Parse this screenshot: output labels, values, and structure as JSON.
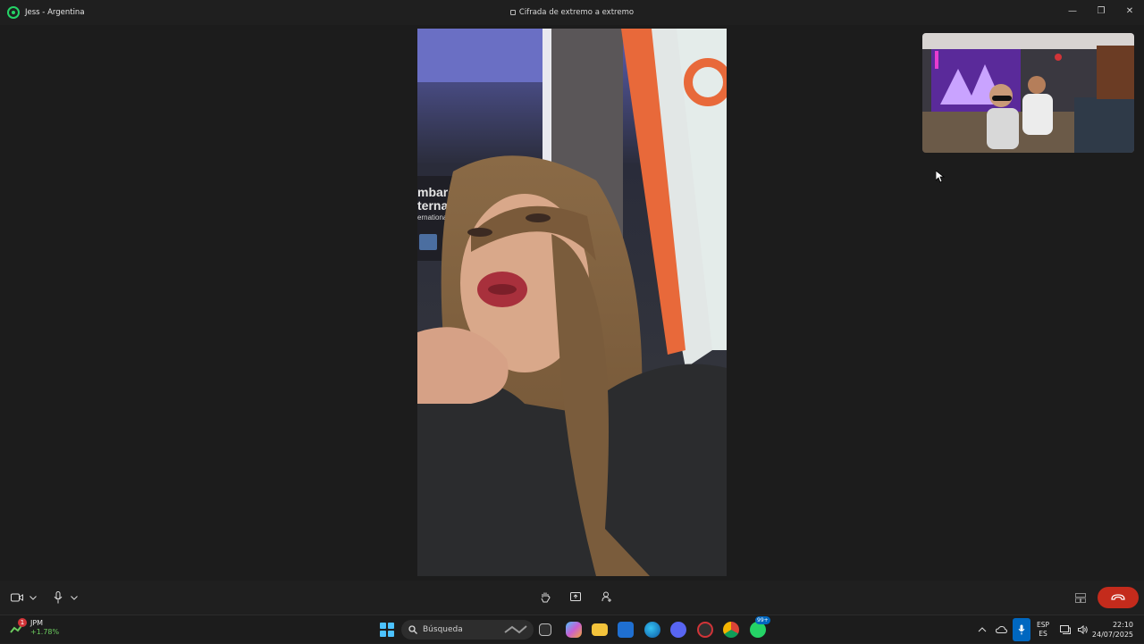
{
  "window": {
    "contact_name": "Jess - Argentina",
    "encryption_label": "Cifrada de extremo a extremo",
    "minimize": "—",
    "maximize": "❐",
    "close": "✕"
  },
  "video": {
    "main_sign_line1": "mbarque",
    "main_sign_line2": "ternac",
    "main_sign_line3": "ernational"
  },
  "taskbar": {
    "stock_name": "JPM",
    "stock_change": "+1.78%",
    "stock_badge": "1",
    "search_placeholder": "Búsqueda",
    "whatsapp_badge": "99+",
    "lang_top": "ESP",
    "lang_bottom": "ES",
    "time": "22:10",
    "date": "24/07/2025"
  },
  "colors": {
    "end_call": "#c42b1c",
    "whatsapp_green": "#25d366",
    "accent_blue": "#0067c0"
  }
}
